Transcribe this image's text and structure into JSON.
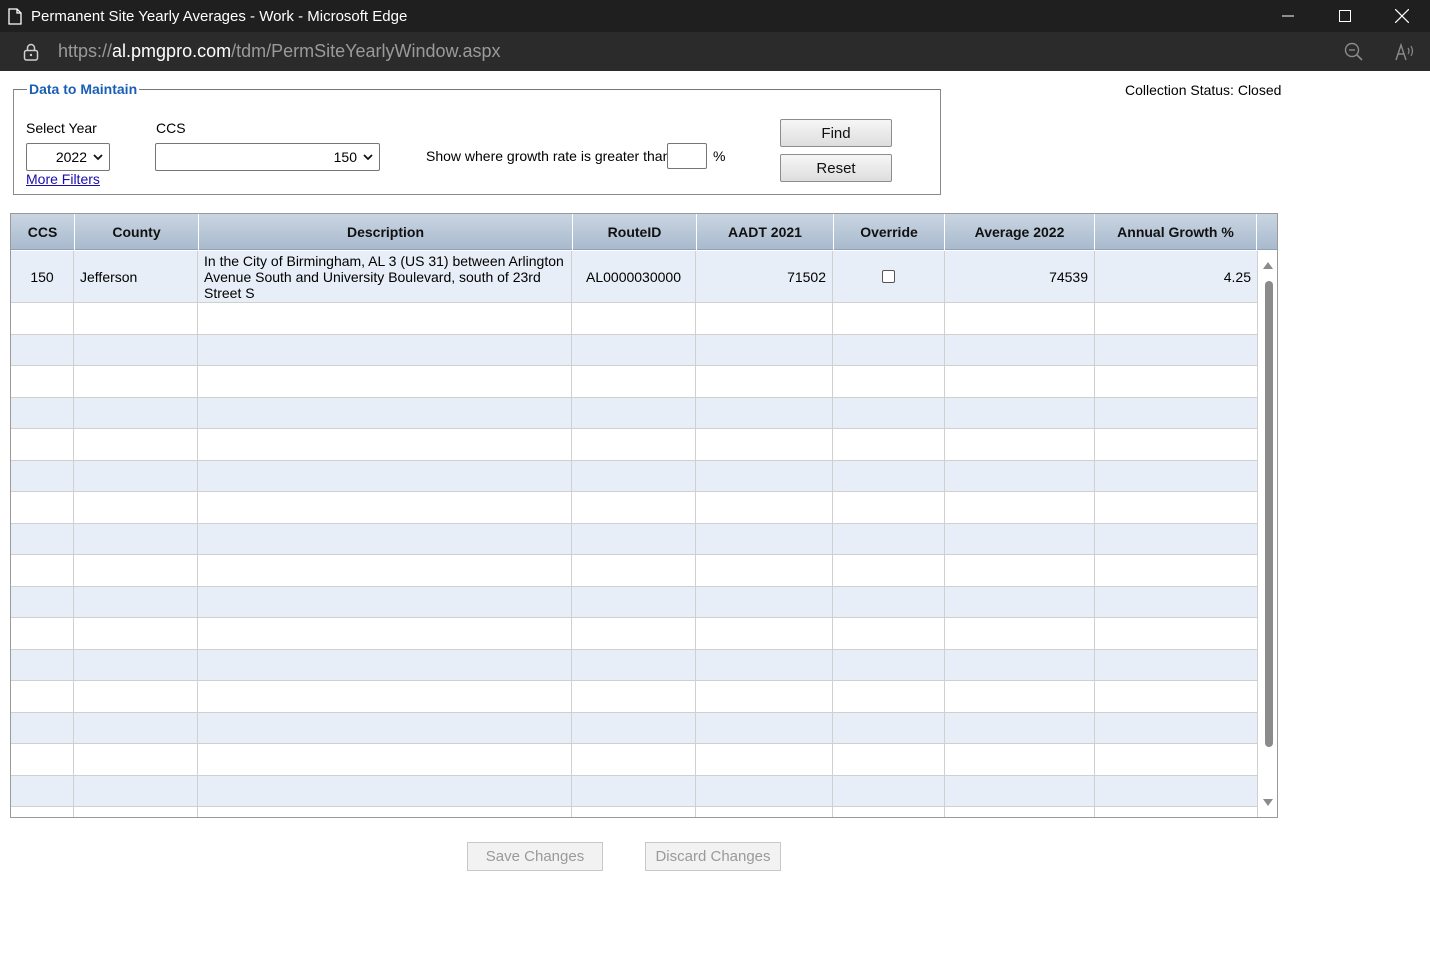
{
  "window": {
    "title": "Permanent Site Yearly Averages - Work - Microsoft Edge"
  },
  "address": {
    "scheme": "https://",
    "host": "al.pmgpro.com",
    "path": "/tdm/PermSiteYearlyWindow.aspx"
  },
  "filters": {
    "legend": "Data to Maintain",
    "year_label": "Select Year",
    "year_value": "2022",
    "ccs_label": "CCS",
    "ccs_value": "150",
    "more_filters": "More Filters",
    "growth_label": "Show where growth rate is greater than:",
    "growth_value": "",
    "percent": "%",
    "find": "Find",
    "reset": "Reset"
  },
  "collection_status": "Collection Status: Closed",
  "grid": {
    "headers": [
      "CCS",
      "County",
      "Description",
      "RouteID",
      "AADT 2021",
      "Override",
      "Average 2022",
      "Annual Growth %"
    ],
    "rows": [
      {
        "ccs": "150",
        "county": "Jefferson",
        "description": "In the City of Birmingham, AL 3 (US 31) between Arlington Avenue South and University Boulevard, south of 23rd Street S",
        "route_id": "AL0000030000",
        "aadt_2021": "71502",
        "override": false,
        "average_2022": "74539",
        "annual_growth": "4.25"
      }
    ]
  },
  "actions": {
    "save": "Save Changes",
    "discard": "Discard Changes"
  }
}
